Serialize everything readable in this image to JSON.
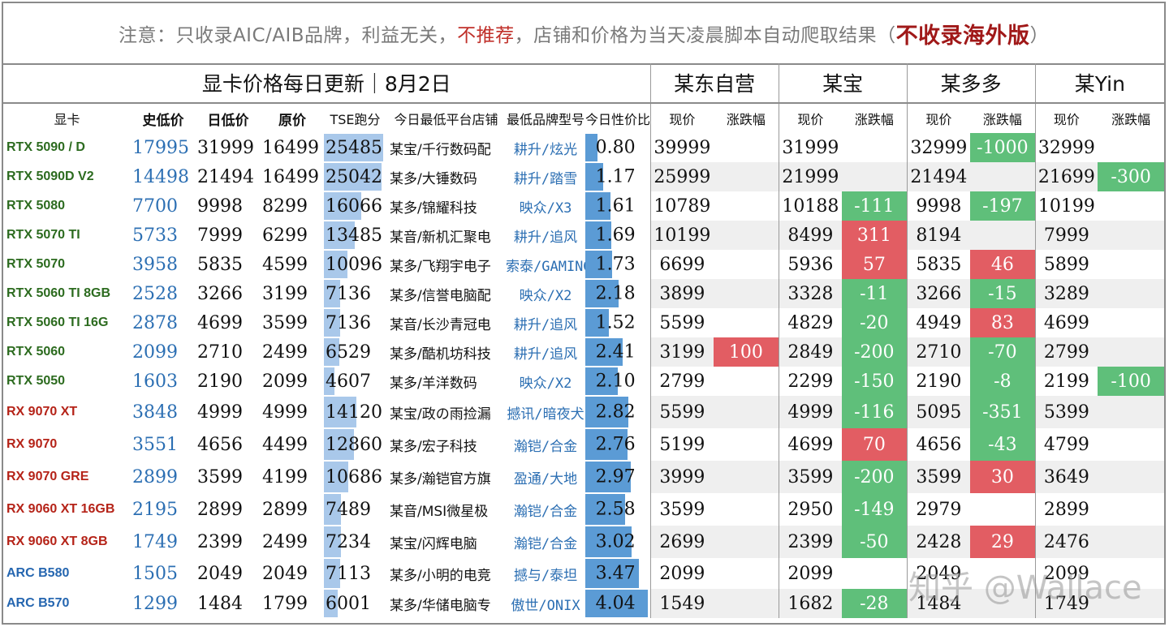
{
  "notice": {
    "part1": "注意：只收录AIC/AIB品牌，利益无关，",
    "part2": "不推荐",
    "part3": "，店铺和价格为当天凌晨脚本自动爬取结果（",
    "part4": "不收录海外版",
    "part5": "）"
  },
  "header": {
    "title": "显卡价格每日更新｜8月2日",
    "platforms": [
      "某东自营",
      "某宝",
      "某多多",
      "某Yin"
    ]
  },
  "columns": {
    "gpu": "显卡",
    "hist_low": "史低价",
    "day_low": "日低价",
    "msrp": "原价",
    "tse": "TSE跑分",
    "platform_store": "今日最低平台店铺",
    "brand_model": "最低品牌型号",
    "ratio": "今日性价比",
    "current": "现价",
    "change": "涨跌幅"
  },
  "colors": {
    "nvidia": "#2c6b1f",
    "amd": "#b52318",
    "intel": "#2566b0",
    "increase": "#e25d63",
    "decrease": "#5fbf7a",
    "tse_bar": "#a9c8ea",
    "ratio_bar": "#5b9bd5"
  },
  "rows": [
    {
      "name": "RTX 5090 / D",
      "vendor": "green",
      "hist_low": "17995",
      "day_low": "31999",
      "msrp": "16499",
      "tse": "25485",
      "store": "某宝/千行数码配",
      "model": "耕升/炫光",
      "ratio": "0.80",
      "jd": "39999",
      "jd_chg": "",
      "tb": "31999",
      "tb_chg": "",
      "pdd": "32999",
      "pdd_chg": "-1000",
      "dy": "32999",
      "dy_chg": ""
    },
    {
      "name": "RTX 5090D V2",
      "vendor": "green",
      "hist_low": "14498",
      "day_low": "21494",
      "msrp": "16499",
      "tse": "25042",
      "store": "某多/大锤数码",
      "model": "耕升/踏雪",
      "ratio": "1.17",
      "jd": "25999",
      "jd_chg": "",
      "tb": "21999",
      "tb_chg": "",
      "pdd": "21494",
      "pdd_chg": "",
      "dy": "21699",
      "dy_chg": "-300"
    },
    {
      "name": "RTX 5080",
      "vendor": "green",
      "hist_low": "7700",
      "day_low": "9998",
      "msrp": "8299",
      "tse": "16066",
      "store": "某多/锦耀科技",
      "model": "映众/X3",
      "ratio": "1.61",
      "jd": "10789",
      "jd_chg": "",
      "tb": "10188",
      "tb_chg": "-111",
      "pdd": "9998",
      "pdd_chg": "-197",
      "dy": "10199",
      "dy_chg": ""
    },
    {
      "name": "RTX 5070 TI",
      "vendor": "green",
      "hist_low": "5733",
      "day_low": "7999",
      "msrp": "6299",
      "tse": "13485",
      "store": "某音/新机汇聚电",
      "model": "耕升/追风",
      "ratio": "1.69",
      "jd": "10199",
      "jd_chg": "",
      "tb": "8499",
      "tb_chg": "311",
      "pdd": "8194",
      "pdd_chg": "",
      "dy": "7999",
      "dy_chg": ""
    },
    {
      "name": "RTX 5070",
      "vendor": "green",
      "hist_low": "3958",
      "day_low": "5835",
      "msrp": "4599",
      "tse": "10096",
      "store": "某多/飞翔宇电子",
      "model": "索泰/GAMING",
      "ratio": "1.73",
      "jd": "6699",
      "jd_chg": "",
      "tb": "5936",
      "tb_chg": "57",
      "pdd": "5835",
      "pdd_chg": "46",
      "dy": "5899",
      "dy_chg": ""
    },
    {
      "name": "RTX 5060 TI 8GB",
      "vendor": "green",
      "hist_low": "2528",
      "day_low": "3266",
      "msrp": "3199",
      "tse": "7136",
      "store": "某多/信誉电脑配",
      "model": "映众/X2",
      "ratio": "2.18",
      "jd": "3899",
      "jd_chg": "",
      "tb": "3328",
      "tb_chg": "-11",
      "pdd": "3266",
      "pdd_chg": "-15",
      "dy": "3289",
      "dy_chg": ""
    },
    {
      "name": "RTX 5060 TI 16G",
      "vendor": "green",
      "hist_low": "2878",
      "day_low": "4699",
      "msrp": "3599",
      "tse": "7136",
      "store": "某音/长沙青冠电",
      "model": "耕升/追风",
      "ratio": "1.52",
      "jd": "5599",
      "jd_chg": "",
      "tb": "4829",
      "tb_chg": "-20",
      "pdd": "4949",
      "pdd_chg": "83",
      "dy": "4699",
      "dy_chg": ""
    },
    {
      "name": "RTX 5060",
      "vendor": "green",
      "hist_low": "2099",
      "day_low": "2710",
      "msrp": "2499",
      "tse": "6529",
      "store": "某多/酷机坊科技",
      "model": "耕升/追风",
      "ratio": "2.41",
      "jd": "3199",
      "jd_chg": "100",
      "tb": "2849",
      "tb_chg": "-200",
      "pdd": "2710",
      "pdd_chg": "-70",
      "dy": "2799",
      "dy_chg": ""
    },
    {
      "name": "RTX 5050",
      "vendor": "green",
      "hist_low": "1603",
      "day_low": "2190",
      "msrp": "2099",
      "tse": "4607",
      "store": "某多/羊洋数码",
      "model": "映众/X2",
      "ratio": "2.10",
      "jd": "2799",
      "jd_chg": "",
      "tb": "2299",
      "tb_chg": "-150",
      "pdd": "2190",
      "pdd_chg": "-8",
      "dy": "2199",
      "dy_chg": "-100"
    },
    {
      "name": "RX 9070 XT",
      "vendor": "red",
      "hist_low": "3848",
      "day_low": "4999",
      "msrp": "4999",
      "tse": "14120",
      "store": "某宝/政の雨捡漏",
      "model": "撼讯/暗夜犬",
      "ratio": "2.82",
      "jd": "5599",
      "jd_chg": "",
      "tb": "4999",
      "tb_chg": "-116",
      "pdd": "5095",
      "pdd_chg": "-351",
      "dy": "5399",
      "dy_chg": ""
    },
    {
      "name": "RX 9070",
      "vendor": "red",
      "hist_low": "3551",
      "day_low": "4656",
      "msrp": "4499",
      "tse": "12860",
      "store": "某多/宏子科技",
      "model": "瀚铠/合金",
      "ratio": "2.76",
      "jd": "5199",
      "jd_chg": "",
      "tb": "4699",
      "tb_chg": "70",
      "pdd": "4656",
      "pdd_chg": "-43",
      "dy": "4799",
      "dy_chg": ""
    },
    {
      "name": "RX 9070 GRE",
      "vendor": "red",
      "hist_low": "2899",
      "day_low": "3599",
      "msrp": "4199",
      "tse": "10686",
      "store": "某多/瀚铠官方旗",
      "model": "盈通/大地",
      "ratio": "2.97",
      "jd": "3999",
      "jd_chg": "",
      "tb": "3599",
      "tb_chg": "-200",
      "pdd": "3599",
      "pdd_chg": "30",
      "dy": "3649",
      "dy_chg": ""
    },
    {
      "name": "RX 9060 XT 16GB",
      "vendor": "red",
      "hist_low": "2195",
      "day_low": "2899",
      "msrp": "2899",
      "tse": "7489",
      "store": "某音/MSI微星极",
      "model": "瀚铠/合金",
      "ratio": "2.58",
      "jd": "3599",
      "jd_chg": "",
      "tb": "2950",
      "tb_chg": "-149",
      "pdd": "2979",
      "pdd_chg": "",
      "dy": "2899",
      "dy_chg": ""
    },
    {
      "name": "RX 9060 XT 8GB",
      "vendor": "red",
      "hist_low": "1749",
      "day_low": "2399",
      "msrp": "2499",
      "tse": "7234",
      "store": "某宝/闪辉电脑",
      "model": "瀚铠/合金",
      "ratio": "3.02",
      "jd": "2699",
      "jd_chg": "",
      "tb": "2399",
      "tb_chg": "-50",
      "pdd": "2428",
      "pdd_chg": "29",
      "dy": "2476",
      "dy_chg": ""
    },
    {
      "name": "ARC B580",
      "vendor": "blue",
      "hist_low": "1505",
      "day_low": "2049",
      "msrp": "2049",
      "tse": "7113",
      "store": "某多/小明的电竞",
      "model": "撼与/泰坦",
      "ratio": "3.47",
      "jd": "2099",
      "jd_chg": "",
      "tb": "2099",
      "tb_chg": "",
      "pdd": "2049",
      "pdd_chg": "",
      "dy": "2099",
      "dy_chg": ""
    },
    {
      "name": "ARC B570",
      "vendor": "blue",
      "hist_low": "1299",
      "day_low": "1484",
      "msrp": "1799",
      "tse": "6001",
      "store": "某多/华储电脑专",
      "model": "傲世/ONIX",
      "ratio": "4.04",
      "jd": "1549",
      "jd_chg": "",
      "tb": "1682",
      "tb_chg": "-28",
      "pdd": "1484",
      "pdd_chg": "",
      "dy": "1749",
      "dy_chg": ""
    }
  ],
  "watermark": "知乎 @Wallace"
}
